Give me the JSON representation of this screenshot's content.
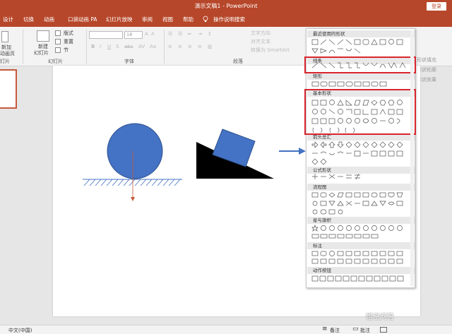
{
  "window": {
    "title": "演示文稿1 - PowerPoint",
    "login": "登录"
  },
  "tabs": [
    "设计",
    "切换",
    "动画",
    "口袋动画 PA",
    "幻灯片放映",
    "审阅",
    "视图",
    "帮助",
    "操作说明搜索"
  ],
  "ribbon": {
    "clipboard_label": "幻灯片",
    "new_slide": "新建",
    "new_slide2": "幻灯片",
    "layout": "版式",
    "reset": "重置",
    "section": "节",
    "add_anim": "新加",
    "add_anim2": "动画页",
    "slides_group": "幻灯片",
    "font_group": "字体",
    "font_size": "18",
    "para_group": "段落",
    "text_direction": "文字方向",
    "align_text": "对齐文本",
    "smartart": "转换为 SmartArt",
    "left_group": "灯片",
    "right_peek1": "形状填充",
    "right_peek2": "形状轮廓",
    "right_peek3": "形状效果"
  },
  "gallery": {
    "sections": [
      "最近使用的形状",
      "线条",
      "矩形",
      "基本形状",
      "箭头总汇",
      "公式形状",
      "流程图",
      "星与旗帜",
      "标注",
      "动作按钮"
    ]
  },
  "status": {
    "language": "中文(中国)",
    "notes": "备注",
    "comments": "批注"
  },
  "watermark": "悟空问答"
}
